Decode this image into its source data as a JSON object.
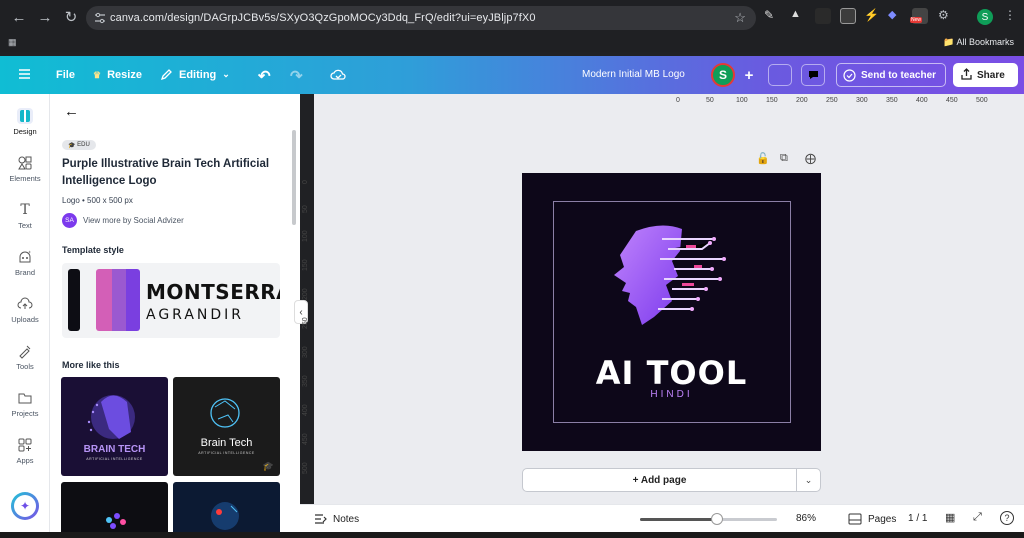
{
  "browser": {
    "url": "canva.com/design/DAGrpJCBv5s/SXyO3QzGpoMOCy3Ddq_FrQ/edit?ui=eyJBljp7fX0",
    "profile_initial": "S",
    "all_bookmarks": "All Bookmarks",
    "ext_badge": "New"
  },
  "topbar": {
    "file": "File",
    "resize": "Resize",
    "editing": "Editing",
    "doc_title": "Modern Initial MB Logo",
    "avatar": "S",
    "send_to_teacher": "Send to teacher",
    "share": "Share",
    "gradient": [
      "#10bdd4",
      "#7a4ee5"
    ]
  },
  "rail": {
    "items": [
      {
        "label": "Design",
        "icon": "design-icon"
      },
      {
        "label": "Elements",
        "icon": "elements-icon"
      },
      {
        "label": "Text",
        "icon": "text-icon"
      },
      {
        "label": "Brand",
        "icon": "brand-icon"
      },
      {
        "label": "Uploads",
        "icon": "uploads-icon"
      },
      {
        "label": "Tools",
        "icon": "tools-icon"
      },
      {
        "label": "Projects",
        "icon": "projects-icon"
      },
      {
        "label": "Apps",
        "icon": "apps-icon"
      }
    ]
  },
  "panel": {
    "badge": "EDU",
    "title": "Purple Illustrative Brain Tech Artificial Intelligence Logo",
    "meta": "Logo • 500 x 500 px",
    "author_initials": "SA",
    "author": "View more by Social Advizer",
    "template_style": "Template style",
    "font1": "MONTSERRAT",
    "font2": "AGRANDIR",
    "swatches": [
      "#0d0d14",
      "#d35fb7",
      "#9b59d0",
      "#7a3fe0"
    ],
    "more_like_this": "More like this",
    "thumbs": [
      {
        "title": "BRAIN TECH",
        "sub": "ARTIFICIAL INTELLIGENCE"
      },
      {
        "title": "Brain Tech",
        "sub": "ARTIFICIAL INTELLIGENCE"
      },
      {
        "title": "",
        "sub": ""
      },
      {
        "title": "",
        "sub": ""
      }
    ]
  },
  "canvas": {
    "ruler_x": [
      "0",
      "50",
      "100",
      "150",
      "200",
      "250",
      "300",
      "350",
      "400",
      "450",
      "500"
    ],
    "ruler_y": [
      "0",
      "50",
      "100",
      "150",
      "200",
      "250",
      "300",
      "350",
      "400",
      "450",
      "500"
    ],
    "headline": "AI TOOL",
    "subline": "HINDI",
    "add_page": "+ Add page"
  },
  "bottombar": {
    "notes": "Notes",
    "zoom_level": 0.86,
    "zoom": "86%",
    "pages": "Pages",
    "page_num": "1 / 1"
  }
}
